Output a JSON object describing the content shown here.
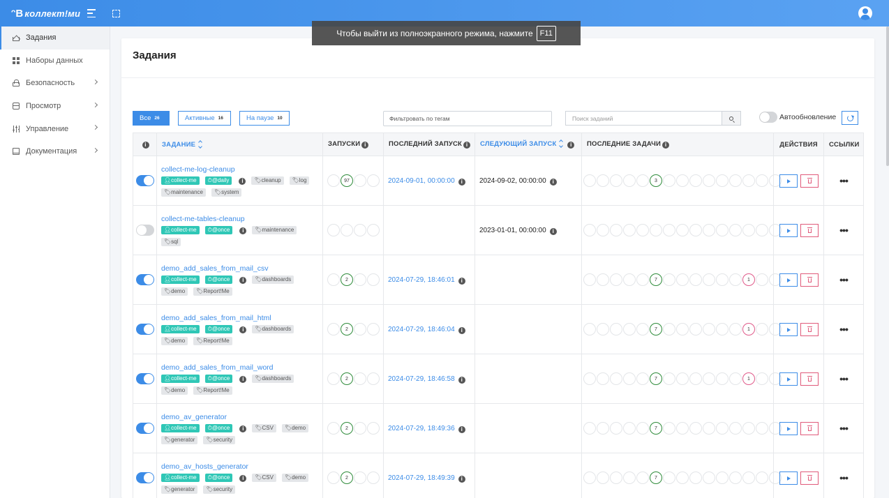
{
  "app": {
    "logo_text": "коллект!ми"
  },
  "fullscreen_notice": {
    "text": "Чтобы выйти из полноэкранного режима, нажмите",
    "key": "F11"
  },
  "sidebar": {
    "items": [
      {
        "label": "Задания",
        "icon": "home-icon",
        "active": true,
        "chevron": false
      },
      {
        "label": "Наборы данных",
        "icon": "grid-icon",
        "active": false,
        "chevron": false
      },
      {
        "label": "Безопасность",
        "icon": "lock-icon",
        "active": false,
        "chevron": true
      },
      {
        "label": "Просмотр",
        "icon": "box-icon",
        "active": false,
        "chevron": true
      },
      {
        "label": "Управление",
        "icon": "sliders-icon",
        "active": false,
        "chevron": true
      },
      {
        "label": "Документация",
        "icon": "book-icon",
        "active": false,
        "chevron": true
      }
    ]
  },
  "page": {
    "title": "Задания"
  },
  "filters": {
    "all": {
      "label": "Все",
      "count": "26"
    },
    "active": {
      "label": "Активные",
      "count": "16"
    },
    "paused": {
      "label": "На паузе",
      "count": "10"
    },
    "tag_filter_placeholder": "Фильтровать по тегам",
    "search_placeholder": "Поиск заданий",
    "auto_refresh_label": "Автообновление"
  },
  "table": {
    "headers": {
      "job": "ЗАДАНИЕ",
      "runs": "ЗАПУСКИ",
      "last_run": "ПОСЛЕДНИЙ ЗАПУСК",
      "next_run": "СЛЕДУЮЩИЙ ЗАПУСК",
      "recent_tasks": "ПОСЛЕДНИЕ ЗАДАЧИ",
      "actions": "ДЕЙСТВИЯ",
      "links": "ССЫЛКИ"
    },
    "rows": [
      {
        "enabled": true,
        "name": "collect-me-log-cleanup",
        "owner": "collect-me",
        "schedule": "@daily",
        "tags": [
          "cleanup",
          "log",
          "maintenance",
          "system"
        ],
        "runs": [
          "",
          "97",
          "",
          ""
        ],
        "last_run": "2024-09-01, 00:00:00",
        "next_run": "2024-09-02, 00:00:00",
        "tasks": [
          "",
          "",
          "",
          "",
          "",
          "3",
          "",
          "",
          "",
          "",
          "",
          "",
          "",
          "",
          ""
        ],
        "task_states": [
          "",
          "",
          "",
          "",
          "",
          "ok",
          "",
          "",
          "",
          "",
          "",
          "",
          "",
          "",
          ""
        ]
      },
      {
        "enabled": false,
        "name": "collect-me-tables-cleanup",
        "owner": "collect-me",
        "schedule": "@once",
        "tags": [
          "maintenance",
          "sql"
        ],
        "runs": [
          "",
          "",
          "",
          ""
        ],
        "last_run": "",
        "next_run": "2023-01-01, 00:00:00",
        "tasks": [
          "",
          "",
          "",
          "",
          "",
          "",
          "",
          "",
          "",
          "",
          "",
          "",
          "",
          "",
          ""
        ],
        "task_states": [
          "",
          "",
          "",
          "",
          "",
          "",
          "",
          "",
          "",
          "",
          "",
          "",
          "",
          "",
          ""
        ]
      },
      {
        "enabled": true,
        "name": "demo_add_sales_from_mail_csv",
        "owner": "collect-me",
        "schedule": "@once",
        "tags": [
          "dashboards",
          "demo",
          "Report!Me"
        ],
        "runs": [
          "",
          "2",
          "",
          ""
        ],
        "last_run": "2024-07-29, 18:46:01",
        "next_run": "",
        "tasks": [
          "",
          "",
          "",
          "",
          "",
          "7",
          "",
          "",
          "",
          "",
          "",
          "",
          "1",
          "",
          ""
        ],
        "task_states": [
          "",
          "",
          "",
          "",
          "",
          "ok",
          "",
          "",
          "",
          "",
          "",
          "",
          "err",
          "",
          ""
        ]
      },
      {
        "enabled": true,
        "name": "demo_add_sales_from_mail_html",
        "owner": "collect-me",
        "schedule": "@once",
        "tags": [
          "dashboards",
          "demo",
          "Report!Me"
        ],
        "runs": [
          "",
          "2",
          "",
          ""
        ],
        "last_run": "2024-07-29, 18:46:04",
        "next_run": "",
        "tasks": [
          "",
          "",
          "",
          "",
          "",
          "7",
          "",
          "",
          "",
          "",
          "",
          "",
          "1",
          "",
          ""
        ],
        "task_states": [
          "",
          "",
          "",
          "",
          "",
          "ok",
          "",
          "",
          "",
          "",
          "",
          "",
          "err",
          "",
          ""
        ]
      },
      {
        "enabled": true,
        "name": "demo_add_sales_from_mail_word",
        "owner": "collect-me",
        "schedule": "@once",
        "tags": [
          "dashboards",
          "demo",
          "Report!Me"
        ],
        "runs": [
          "",
          "2",
          "",
          ""
        ],
        "last_run": "2024-07-29, 18:46:58",
        "next_run": "",
        "tasks": [
          "",
          "",
          "",
          "",
          "",
          "7",
          "",
          "",
          "",
          "",
          "",
          "",
          "1",
          "",
          ""
        ],
        "task_states": [
          "",
          "",
          "",
          "",
          "",
          "ok",
          "",
          "",
          "",
          "",
          "",
          "",
          "err",
          "",
          ""
        ]
      },
      {
        "enabled": true,
        "name": "demo_av_generator",
        "owner": "collect-me",
        "schedule": "@once",
        "tags": [
          "CSV",
          "demo",
          "generator",
          "security"
        ],
        "runs": [
          "",
          "2",
          "",
          ""
        ],
        "last_run": "2024-07-29, 18:49:36",
        "next_run": "",
        "tasks": [
          "",
          "",
          "",
          "",
          "",
          "7",
          "",
          "",
          "",
          "",
          "",
          "",
          "",
          "",
          ""
        ],
        "task_states": [
          "",
          "",
          "",
          "",
          "",
          "ok",
          "",
          "",
          "",
          "",
          "",
          "",
          "",
          "",
          ""
        ]
      },
      {
        "enabled": true,
        "name": "demo_av_hosts_generator",
        "owner": "collect-me",
        "schedule": "@once",
        "tags": [
          "CSV",
          "demo",
          "generator",
          "security"
        ],
        "runs": [
          "",
          "2",
          "",
          ""
        ],
        "last_run": "2024-07-29, 18:49:39",
        "next_run": "",
        "tasks": [
          "",
          "",
          "",
          "",
          "",
          "7",
          "",
          "",
          "",
          "",
          "",
          "",
          "",
          "",
          ""
        ],
        "task_states": [
          "",
          "",
          "",
          "",
          "",
          "ok",
          "",
          "",
          "",
          "",
          "",
          "",
          "",
          "",
          ""
        ]
      }
    ]
  },
  "colors": {
    "accent": "#3c8ce7",
    "success": "#2e8b3a",
    "error": "#e05a8a",
    "badge": "#2fc7b6"
  }
}
